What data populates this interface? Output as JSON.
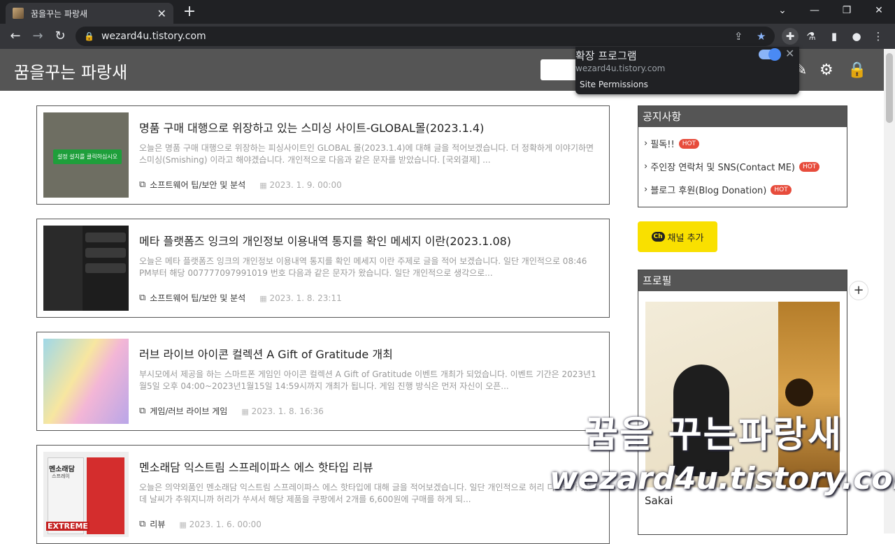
{
  "browser": {
    "tab_title": "꿈을꾸는 파랑새",
    "tab_close": "✕",
    "new_tab": "+",
    "url": "wezard4u.tistory.com"
  },
  "extension_popup": {
    "title": "확장 프로그램",
    "site": "wezard4u.tistory.com",
    "permissions": "Site Permissions"
  },
  "blog": {
    "title": "꿈을꾸는 파랑새"
  },
  "posts": [
    {
      "title": "명품 구매 대행으로 위장하고 있는 스미싱 사이트-GLOBAL몰(2023.1.4)",
      "excerpt": "오늘은 명품 구매 대행으로 위장하는 피싱사이트인 GLOBAL 몰(2023.1.4)에 대해 글을 적어보겠습니다. 더 정확하게 이야기하면 스미싱(Smishing) 이라고 해야겠습니다. 개인적으로 다음과 같은 문자를 받았습니다. [국외결제] ...",
      "category": "소프트웨어 팁/보안 및 분석",
      "date": "2023. 1. 9. 00:00",
      "thumb_text": "설정 설치를 클릭하십시오"
    },
    {
      "title": "메타 플랫폼즈 잉크의 개인정보 이용내역 통지를 확인 메세지 이란(2023.1.08)",
      "excerpt": "오늘은 메타 플랫폼즈 잉크의 개인정보 이용내역 통지를 확인 메세지 이란 주제로 글을 적어 보겠습니다. 일단 개인적으로 08:46 PM부터 해당 007777097991019 번호 다음과 같은 문자가 왔습니다. 일단 개인적으로 생각으로...",
      "category": "소프트웨어 팁/보안 및 분석",
      "date": "2023. 1. 8. 23:11"
    },
    {
      "title": "러브 라이브 아이콘 컬렉션 A Gift of Gratitude 개최",
      "excerpt": "부시모에서 제공을 하는 스마트폰 게임인 아이콘 컬렉션 A Gift of Gratitude 이벤트 개최가 되었습니다. 이벤트 기간은 2023년1월5일 오후 04:00~2023년1월15일 14:59시까지 개최가 됩니다. 게임 진행 방식은 먼저 자신이 오픈...",
      "category": "게임/러브 라이브 게임",
      "date": "2023. 1. 8. 16:36"
    },
    {
      "title": "멘소래담 익스트림 스프레이파스 에스 핫타입 리뷰",
      "excerpt": "오늘은 의약외품인 멘소래담 익스트림 스프레이파스 에스 핫타입에 대해 글을 적어보겠습니다. 일단 개인적으로 허리 디스크가 있는데 날씨가 추워지니까 허리가 쑤셔서 해당 제품을 쿠팡에서 2개를 6,600원에 구매를 하게 되...",
      "category": "리뷰",
      "date": "2023. 1. 6. 00:00",
      "thumb_text": "멘소래담",
      "thumb_sub": "스프레이",
      "thumb_brand": "EXTREME"
    }
  ],
  "sidebar": {
    "notice_title": "공지사항",
    "notices": [
      {
        "label": "필독!!",
        "badge": "HOT"
      },
      {
        "label": "주인장 연락처 및 SNS(Contact ME)",
        "badge": "HOT"
      },
      {
        "label": "블로그 후원(Blog Donation)",
        "badge": "HOT"
      }
    ],
    "channel_button": "채널 추가",
    "channel_icon": "Ch",
    "profile_title": "프로필",
    "profile_name": "Sakai"
  },
  "watermark": {
    "line1": "꿈을 꾸는파랑새",
    "line2": "wezard4u.tistory.com"
  }
}
